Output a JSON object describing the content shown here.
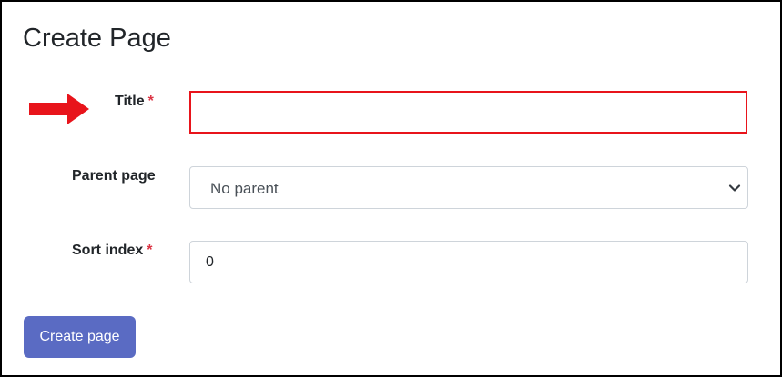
{
  "page": {
    "title": "Create Page"
  },
  "form": {
    "title_field": {
      "label": "Title",
      "required_marker": "*",
      "value": ""
    },
    "parent_field": {
      "label": "Parent page",
      "selected": "No parent"
    },
    "sort_field": {
      "label": "Sort index",
      "required_marker": "*",
      "value": "0"
    },
    "submit_label": "Create page"
  },
  "colors": {
    "arrow": "#e8141b",
    "title_input_highlight": "#e8141b",
    "required_marker": "#dc3545",
    "primary_button": "#5a6bc3"
  },
  "icons": {
    "arrow": "arrow-right-icon",
    "select": "chevron-down-icon"
  }
}
